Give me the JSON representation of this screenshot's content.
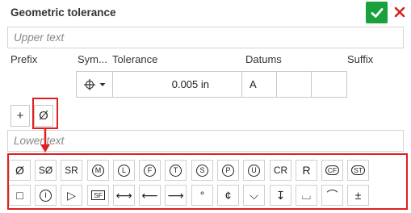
{
  "dialog": {
    "title": "Geometric tolerance"
  },
  "upper_text": {
    "placeholder": "Upper text"
  },
  "lower_text": {
    "placeholder": "Lower text"
  },
  "columns": {
    "prefix": "Prefix",
    "symbol": "Sym...",
    "tolerance": "Tolerance",
    "datums": "Datums",
    "suffix": "Suffix"
  },
  "frame": {
    "symbol_icon": "position-icon",
    "tolerance_value": "0.005 in",
    "datums": [
      "A",
      "",
      ""
    ]
  },
  "buttons": {
    "add_label": "+",
    "diameter_label": "Ø"
  },
  "palette_row1": [
    {
      "name": "diameter-symbol-button",
      "label": "Ø"
    },
    {
      "name": "spherical-diameter-symbol-button",
      "label": "SØ"
    },
    {
      "name": "spherical-radius-symbol-button",
      "label": "SR"
    },
    {
      "name": "mmc-symbol-button",
      "label": "M"
    },
    {
      "name": "lmc-symbol-button",
      "label": "L"
    },
    {
      "name": "free-state-symbol-button",
      "label": "F"
    },
    {
      "name": "tangent-plane-symbol-button",
      "label": "T"
    },
    {
      "name": "rfs-symbol-button",
      "label": "S"
    },
    {
      "name": "projected-tolerance-symbol-button",
      "label": "P"
    },
    {
      "name": "unequal-bilateral-symbol-button",
      "label": "U"
    },
    {
      "name": "controlled-radius-symbol-button",
      "label": "CR"
    },
    {
      "name": "radius-symbol-button",
      "label": "R"
    },
    {
      "name": "continuous-feature-symbol-button",
      "label": "CF"
    },
    {
      "name": "statistical-tolerance-symbol-button",
      "label": "ST"
    }
  ],
  "palette_row2": [
    {
      "name": "square-symbol-button",
      "label": "□"
    },
    {
      "name": "independency-symbol-button",
      "label": "I"
    },
    {
      "name": "triangle-symbol-button",
      "label": "▷"
    },
    {
      "name": "sf-symbol-button",
      "label": "SF"
    },
    {
      "name": "between-symbol-button",
      "label": "⟷"
    },
    {
      "name": "left-arrow-symbol-button",
      "label": "⟵"
    },
    {
      "name": "right-arrow-symbol-button",
      "label": "⟶"
    },
    {
      "name": "degree-symbol-button",
      "label": "°"
    },
    {
      "name": "centerline-symbol-button",
      "label": "¢"
    },
    {
      "name": "countersink-symbol-button",
      "label": "⌵"
    },
    {
      "name": "depth-symbol-button",
      "label": "↧"
    },
    {
      "name": "counterbore-symbol-button",
      "label": "⌴"
    },
    {
      "name": "arc-length-symbol-button",
      "label": "⌒"
    },
    {
      "name": "plus-minus-symbol-button",
      "label": "±"
    }
  ],
  "colors": {
    "accent_green": "#1aa13d",
    "cancel_red": "#d42020",
    "highlight_red": "#e02020"
  }
}
